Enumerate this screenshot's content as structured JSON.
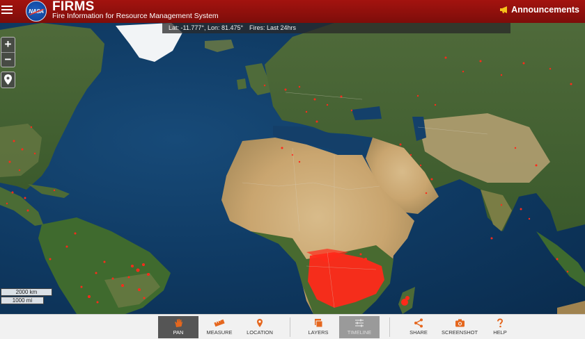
{
  "header": {
    "logo_text": "NASA",
    "title": "FIRMS",
    "subtitle": "Fire Information for Resource Management System",
    "announcements_label": "Announcements"
  },
  "map": {
    "coords_text": "Lat: -11.777°, Lon: 81.475°",
    "fires_text": "Fires: Last 24hrs",
    "zoom_in": "+",
    "zoom_out": "−",
    "scale_km": "2000 km",
    "scale_mi": "1000 mi"
  },
  "toolbar": {
    "tools": [
      {
        "label": "PAN",
        "icon": "hand-icon",
        "state": "active"
      },
      {
        "label": "MEASURE",
        "icon": "ruler-icon",
        "state": "normal"
      },
      {
        "label": "LOCATION",
        "icon": "map-pin-icon",
        "state": "normal"
      },
      {
        "label": "LAYERS",
        "icon": "layers-icon",
        "state": "normal"
      },
      {
        "label": "TIMELINE",
        "icon": "sliders-icon",
        "state": "disabled"
      },
      {
        "label": "SHARE",
        "icon": "share-icon",
        "state": "normal"
      },
      {
        "label": "SCREENSHOT",
        "icon": "camera-icon",
        "state": "normal"
      },
      {
        "label": "HELP",
        "icon": "question-icon",
        "state": "normal"
      }
    ]
  },
  "colors": {
    "header": "#9a110d",
    "accent": "#e5671e",
    "fire": "#ff2a1a"
  }
}
